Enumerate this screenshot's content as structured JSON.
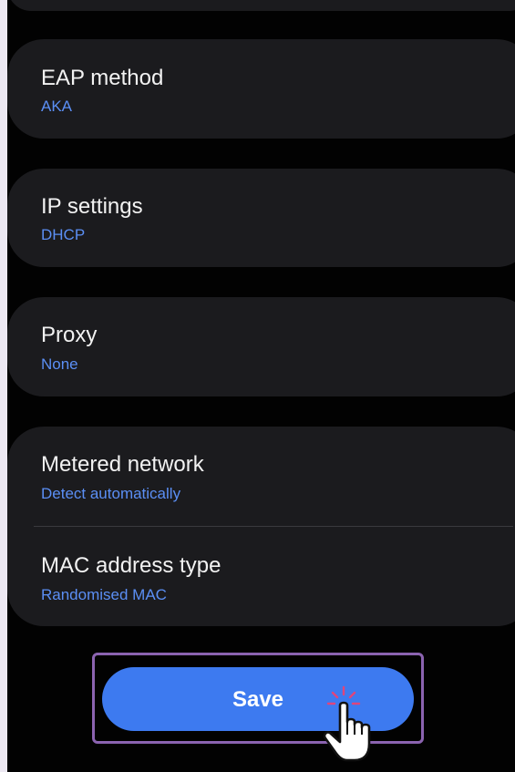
{
  "settings": {
    "eap_method": {
      "title": "EAP method",
      "value": "AKA"
    },
    "ip_settings": {
      "title": "IP settings",
      "value": "DHCP"
    },
    "proxy": {
      "title": "Proxy",
      "value": "None"
    },
    "metered_network": {
      "title": "Metered network",
      "value": "Detect automatically"
    },
    "mac_address_type": {
      "title": "MAC address type",
      "value": "Randomised MAC"
    }
  },
  "save_button": {
    "label": "Save"
  },
  "colors": {
    "background": "#020202",
    "card": "#1b1b1e",
    "value_text": "#5b8ff5",
    "primary_button": "#3d7af0",
    "highlight_frame": "#8b63b0"
  },
  "icons": {
    "pointer": "hand-pointer-icon"
  }
}
